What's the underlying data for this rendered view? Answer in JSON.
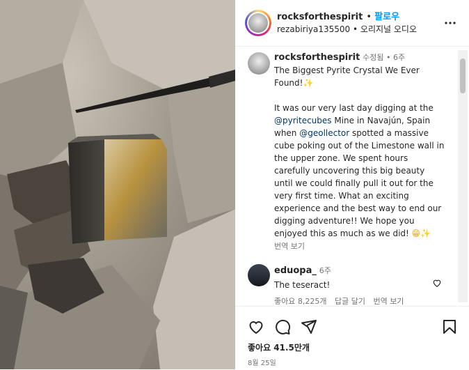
{
  "post": {
    "username": "rocksforthespirit",
    "follow_label": "팔로우",
    "audio_user": "rezabiriya135500",
    "audio_label": "오리지널 오디오",
    "edited_label": "수정됨",
    "time_ago": "6주",
    "caption_title": "The Biggest Pyrite Crystal We Ever Found!",
    "caption_p1": "It was our very last day digging at the",
    "mention1": "@pyritecubes",
    "caption_p2": " Mine in Navajún, Spain when ",
    "mention2": "@geollector",
    "caption_p3": " spotted a massive cube poking out of the Limestone wall in the upper zone. We spent hours carefully uncovering this big beauty until we could finally pull it out for the very first time. What an exciting experience and the best way to end our digging adventure!! We hope you enjoyed this as much as we did!",
    "see_translation": "번역 보기",
    "comment": {
      "username": "eduopa_",
      "time_ago": "6주",
      "text": "The teseract!",
      "likes": "좋아요 8,225개",
      "reply": "답글 달기",
      "translate": "번역 보기"
    },
    "likes_label": "좋아요 41.5만개",
    "date": "8월 25일"
  },
  "icons": [
    "more-icon",
    "sparkle-emoji",
    "grin-emoji",
    "heart-icon",
    "comment-icon",
    "share-icon",
    "bookmark-icon"
  ]
}
